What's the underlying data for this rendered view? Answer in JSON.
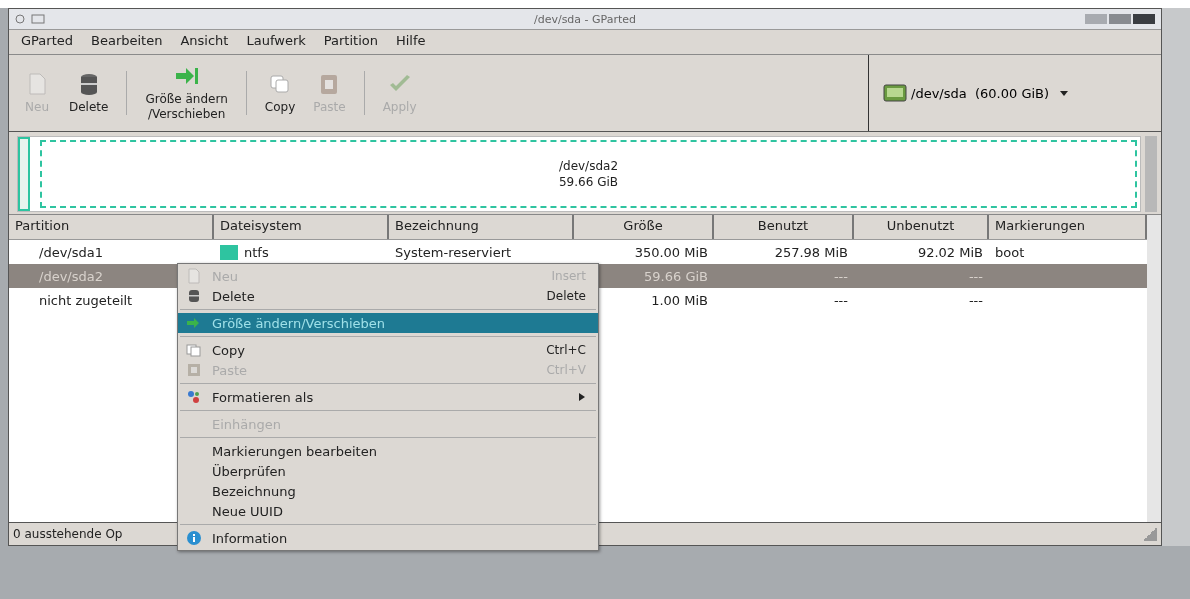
{
  "window": {
    "title": "/dev/sda - GParted"
  },
  "menubar": [
    "GParted",
    "Bearbeiten",
    "Ansicht",
    "Laufwerk",
    "Partition",
    "Hilfe"
  ],
  "toolbar": [
    {
      "label": "Neu",
      "disabled": true
    },
    {
      "label": "Delete",
      "disabled": false
    },
    {
      "label": "Größe ändern\n/Verschieben",
      "disabled": false
    },
    {
      "label": "Copy",
      "disabled": false
    },
    {
      "label": "Paste",
      "disabled": true
    },
    {
      "label": "Apply",
      "disabled": true
    }
  ],
  "device_selector": {
    "value": "/dev/sda  (60.00 GiB)"
  },
  "disk_graph": {
    "partition": "/dev/sda2",
    "size": "59.66 GiB"
  },
  "table": {
    "columns": [
      "Partition",
      "Dateisystem",
      "Bezeichnung",
      "Größe",
      "Benutzt",
      "Unbenutzt",
      "Markierungen"
    ],
    "rows": [
      {
        "partition": "/dev/sda1",
        "filesystem": "ntfs",
        "color": "#2ec4a0",
        "label": "System-reserviert",
        "size": "350.00 MiB",
        "used": "257.98 MiB",
        "unused": "92.02 MiB",
        "flags": "boot",
        "selected": false
      },
      {
        "partition": "/dev/sda2",
        "size": "59.66 GiB",
        "used": "---",
        "unused": "---",
        "selected": true
      },
      {
        "partition": "nicht zugeteilt",
        "size": "1.00 MiB",
        "used": "---",
        "unused": "---",
        "selected": false
      }
    ]
  },
  "status_bar": "0 ausstehende Op",
  "context_menu": [
    {
      "kind": "item",
      "label": "Neu",
      "shortcut": "Insert",
      "disabled": true,
      "selected": false,
      "submenu": false
    },
    {
      "kind": "item",
      "label": "Delete",
      "shortcut": "Delete",
      "disabled": false,
      "selected": false,
      "submenu": false
    },
    {
      "kind": "separator"
    },
    {
      "kind": "item",
      "label": "Größe ändern/Verschieben",
      "disabled": false,
      "selected": true,
      "submenu": false
    },
    {
      "kind": "separator"
    },
    {
      "kind": "item",
      "label": "Copy",
      "shortcut": "Ctrl+C",
      "disabled": false,
      "selected": false,
      "submenu": false
    },
    {
      "kind": "item",
      "label": "Paste",
      "shortcut": "Ctrl+V",
      "disabled": true,
      "selected": false,
      "submenu": false
    },
    {
      "kind": "separator"
    },
    {
      "kind": "item",
      "label": "Formatieren als",
      "disabled": false,
      "selected": false,
      "submenu": true
    },
    {
      "kind": "separator"
    },
    {
      "kind": "item",
      "label": "Einhängen",
      "disabled": true,
      "selected": false,
      "submenu": false
    },
    {
      "kind": "separator"
    },
    {
      "kind": "item",
      "label": "Markierungen bearbeiten",
      "disabled": false,
      "selected": false,
      "submenu": false
    },
    {
      "kind": "item",
      "label": "Überprüfen",
      "disabled": false,
      "selected": false,
      "submenu": false
    },
    {
      "kind": "item",
      "label": "Bezeichnung",
      "disabled": false,
      "selected": false,
      "submenu": false
    },
    {
      "kind": "item",
      "label": "Neue UUID",
      "disabled": false,
      "selected": false,
      "submenu": false
    },
    {
      "kind": "separator"
    },
    {
      "kind": "item",
      "label": "Information",
      "disabled": false,
      "selected": false,
      "submenu": false
    }
  ]
}
